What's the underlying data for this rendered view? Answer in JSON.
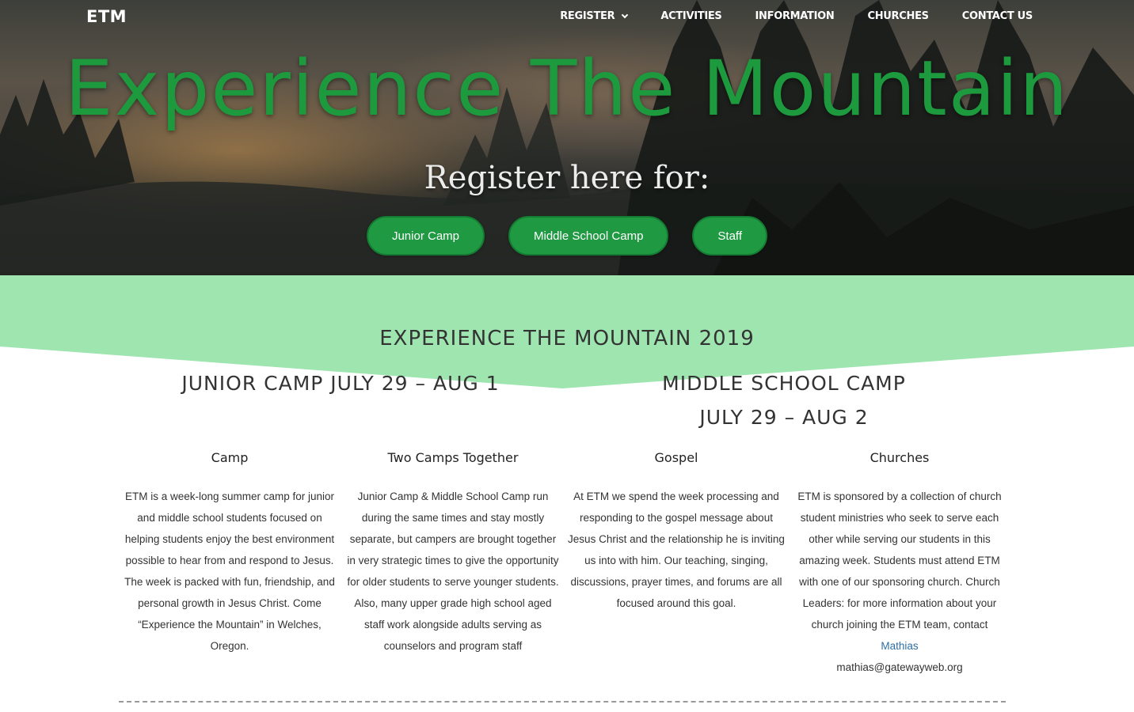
{
  "nav": {
    "brand": "ETM",
    "links": [
      "REGISTER",
      "ACTIVITIES",
      "INFORMATION",
      "CHURCHES",
      "CONTACT US"
    ]
  },
  "hero": {
    "title": "Experience The Mountain",
    "subtitle": "Register here for:",
    "buttons": [
      "Junior Camp",
      "Middle School Camp",
      "Staff"
    ]
  },
  "section": {
    "heading": "EXPERIENCE THE MOUNTAIN 2019",
    "junior_camp": "JUNIOR CAMP JULY 29 – AUG 1",
    "middle_camp_line1": "MIDDLE SCHOOL CAMP",
    "middle_camp_line2": "JULY 29 – AUG 2"
  },
  "columns": [
    {
      "title": "Camp",
      "text": "ETM is a week-long summer camp for junior and middle school students focused on helping students enjoy the best environment possible to hear from and respond to Jesus. The week is packed with fun, friendship, and personal growth in Jesus Christ. Come “Experience the Mountain” in Welches, Oregon."
    },
    {
      "title": "Two Camps Together",
      "text": "Junior Camp & Middle School Camp run during the same times and stay mostly separate, but campers are brought together in very strategic times to give the opportunity for older students to serve younger students. Also, many upper grade high school aged staff work alongside adults serving as counselors and program staff"
    },
    {
      "title": "Gospel",
      "text": "At ETM we spend the week processing and responding to the gospel message about Jesus Christ and the relationship he is inviting us into with him. Our teaching, singing, discussions, prayer times, and forums are all focused around this goal."
    },
    {
      "title": "Churches",
      "text": "ETM is sponsored by a collection of church student ministries who seek to serve each other while serving our students in this amazing week. Students must attend ETM with one of our sponsoring church. Church Leaders: for more information about your church joining the ETM team, contact",
      "link_text": "Mathias",
      "email": "mathias@gatewayweb.org"
    }
  ],
  "colors": {
    "accent_green": "#1e9a3e",
    "band_green": "#9ee5b0",
    "link_blue": "#2f6fa6"
  }
}
